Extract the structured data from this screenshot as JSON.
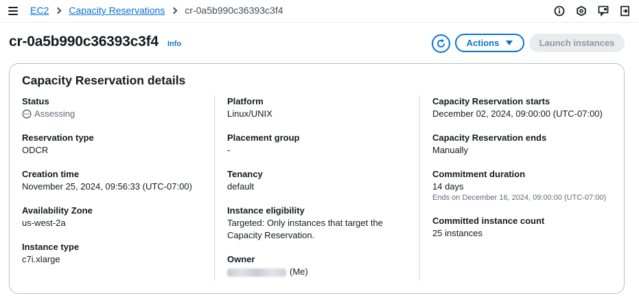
{
  "breadcrumb": {
    "items": [
      "EC2",
      "Capacity Reservations"
    ],
    "current": "cr-0a5b990c36393c3f4"
  },
  "header": {
    "title": "cr-0a5b990c36393c3f4",
    "info": "Info",
    "actions_label": "Actions",
    "launch_label": "Launch instances"
  },
  "top_icons": [
    "info-circle-icon",
    "settings-hex-icon",
    "feedback-icon",
    "exit-panel-icon"
  ],
  "details": {
    "title": "Capacity Reservation details",
    "col1": {
      "status_label": "Status",
      "status_value": "Assessing",
      "reservation_type_label": "Reservation type",
      "reservation_type_value": "ODCR",
      "creation_time_label": "Creation time",
      "creation_time_value": "November 25, 2024, 09:56:33 (UTC-07:00)",
      "az_label": "Availability Zone",
      "az_value": "us-west-2a",
      "instance_type_label": "Instance type",
      "instance_type_value": "c7i.xlarge"
    },
    "col2": {
      "platform_label": "Platform",
      "platform_value": "Linux/UNIX",
      "placement_group_label": "Placement group",
      "placement_group_value": "-",
      "tenancy_label": "Tenancy",
      "tenancy_value": "default",
      "eligibility_label": "Instance eligibility",
      "eligibility_value": "Targeted: Only instances that target the Capacity Reservation.",
      "owner_label": "Owner",
      "owner_suffix": "(Me)"
    },
    "col3": {
      "starts_label": "Capacity Reservation starts",
      "starts_value": "December 02, 2024, 09:00:00 (UTC-07:00)",
      "ends_label": "Capacity Reservation ends",
      "ends_value": "Manually",
      "commitment_label": "Commitment duration",
      "commitment_value": "14 days",
      "commitment_sub": "Ends on December 16, 2024, 09:00:00 (UTC-07:00)",
      "count_label": "Committed instance count",
      "count_value": "25 instances"
    }
  },
  "colors": {
    "link": "#0972d3",
    "text": "#16191f",
    "muted": "#5f6b7a",
    "disabled_bg": "#e9ebed"
  }
}
